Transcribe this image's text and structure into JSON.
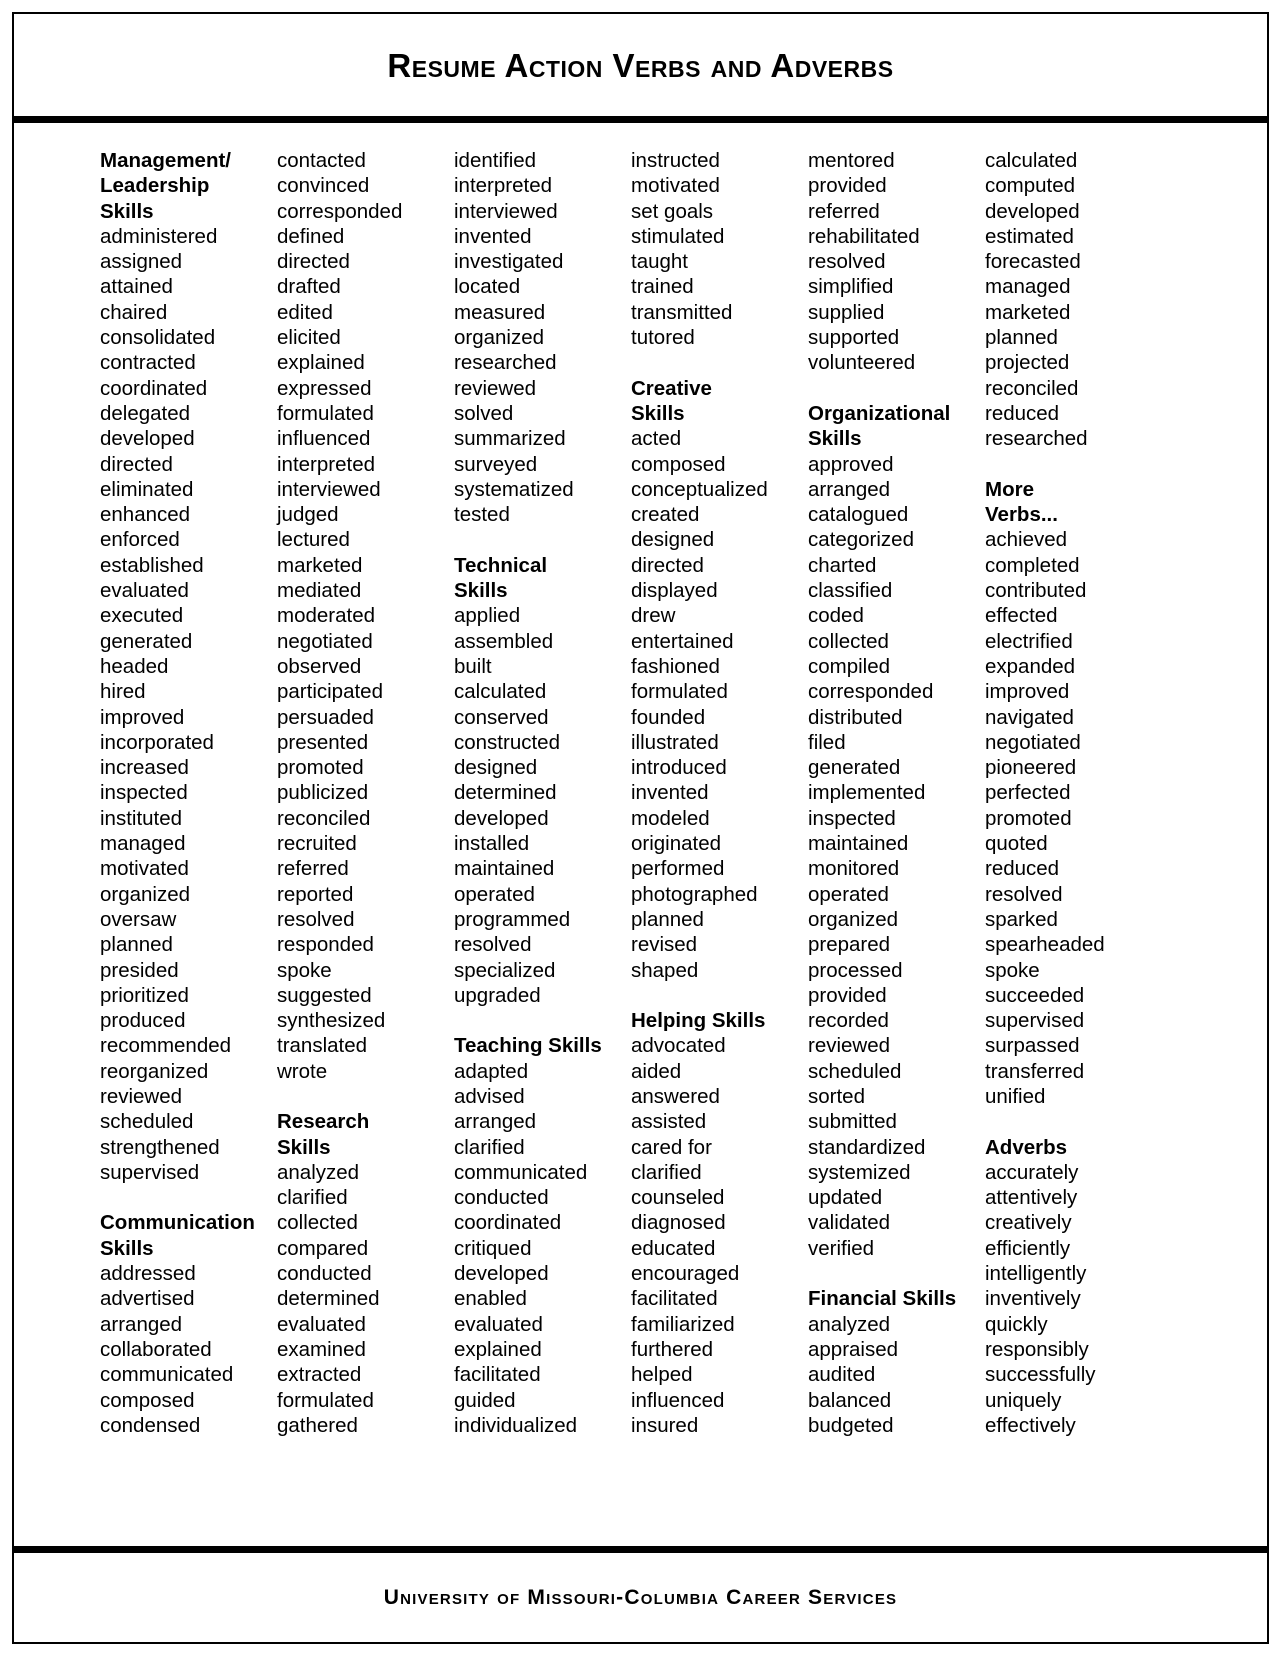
{
  "document": {
    "title": "Resume Action Verbs and Adverbs",
    "footer": "University of Missouri-Columbia Career Services"
  },
  "columns": [
    {
      "name": "column-1",
      "blocks": [
        {
          "type": "category",
          "heading_lines": [
            "Management/",
            "Leadership",
            "Skills"
          ],
          "words": [
            "administered",
            "assigned",
            "attained",
            "chaired",
            "consolidated",
            "contracted",
            "coordinated",
            "delegated",
            "developed",
            "directed",
            "eliminated",
            "enhanced",
            "enforced",
            "established",
            "evaluated",
            "executed",
            "generated",
            "headed",
            "hired",
            "improved",
            "incorporated",
            "increased",
            "inspected",
            "instituted",
            "managed",
            "motivated",
            "organized",
            "oversaw",
            "planned",
            "presided",
            "prioritized",
            "produced",
            "recommended",
            "reorganized",
            "reviewed",
            "scheduled",
            "strengthened",
            "supervised"
          ]
        },
        {
          "type": "category",
          "heading_lines": [
            "Communication",
            "Skills"
          ],
          "words": [
            "addressed",
            "advertised",
            "arranged",
            "collaborated",
            "communicated",
            "composed",
            "condensed"
          ]
        }
      ]
    },
    {
      "name": "column-2",
      "blocks": [
        {
          "type": "continuation",
          "heading_lines": [],
          "words": [
            "contacted",
            "convinced",
            "corresponded",
            "defined",
            "directed",
            "drafted",
            "edited",
            "elicited",
            "explained",
            "expressed",
            "formulated",
            "influenced",
            "interpreted",
            "interviewed",
            "judged",
            "lectured",
            "marketed",
            "mediated",
            "moderated",
            "negotiated",
            "observed",
            "participated",
            "persuaded",
            "presented",
            "promoted",
            "publicized",
            "reconciled",
            "recruited",
            "referred",
            "reported",
            "resolved",
            "responded",
            "spoke",
            "suggested",
            "synthesized",
            "translated",
            "wrote"
          ]
        },
        {
          "type": "category",
          "heading_lines": [
            "Research",
            "Skills"
          ],
          "words": [
            "analyzed",
            "clarified",
            "collected",
            "compared",
            "conducted",
            "determined",
            "evaluated",
            "examined",
            "extracted",
            "formulated",
            "gathered"
          ]
        }
      ]
    },
    {
      "name": "column-3",
      "blocks": [
        {
          "type": "continuation",
          "heading_lines": [],
          "words": [
            "identified",
            "interpreted",
            "interviewed",
            "invented",
            "investigated",
            "located",
            "measured",
            "organized",
            "researched",
            "reviewed",
            "solved",
            "summarized",
            "surveyed",
            "systematized",
            "tested"
          ]
        },
        {
          "type": "category",
          "heading_lines": [
            "Technical",
            "Skills"
          ],
          "words": [
            "applied",
            "assembled",
            "built",
            "calculated",
            "conserved",
            "constructed",
            "designed",
            "determined",
            "developed",
            "installed",
            "maintained",
            "operated",
            "programmed",
            "resolved",
            "specialized",
            "upgraded"
          ]
        },
        {
          "type": "category",
          "heading_lines": [
            "Teaching Skills"
          ],
          "words": [
            "adapted",
            "advised",
            "arranged",
            "clarified",
            "communicated",
            "conducted",
            "coordinated",
            "critiqued",
            "developed",
            "enabled",
            "evaluated",
            "explained",
            "facilitated",
            "guided",
            "individualized"
          ]
        }
      ]
    },
    {
      "name": "column-4",
      "blocks": [
        {
          "type": "continuation",
          "heading_lines": [],
          "words": [
            "instructed",
            "motivated",
            "set goals",
            "stimulated",
            "taught",
            "trained",
            "transmitted",
            "tutored"
          ]
        },
        {
          "type": "category",
          "heading_lines": [
            "Creative",
            "Skills"
          ],
          "words": [
            "acted",
            "composed",
            "conceptualized",
            "created",
            "designed",
            "directed",
            "displayed",
            "drew",
            "entertained",
            "fashioned",
            "formulated",
            "founded",
            "illustrated",
            "introduced",
            "invented",
            "modeled",
            "originated",
            "performed",
            "photographed",
            "planned",
            "revised",
            "shaped"
          ]
        },
        {
          "type": "category",
          "heading_lines": [
            "Helping Skills"
          ],
          "words": [
            "advocated",
            "aided",
            "answered",
            "assisted",
            "cared for",
            "clarified",
            "counseled",
            "diagnosed",
            "educated",
            "encouraged",
            "facilitated",
            "familiarized",
            "furthered",
            "helped",
            "influenced",
            "insured"
          ]
        }
      ]
    },
    {
      "name": "column-5",
      "blocks": [
        {
          "type": "continuation",
          "heading_lines": [],
          "words": [
            "mentored",
            "provided",
            "referred",
            "rehabilitated",
            "resolved",
            "simplified",
            "supplied",
            "supported",
            "volunteered"
          ]
        },
        {
          "type": "category",
          "heading_lines": [
            "Organizational",
            "Skills"
          ],
          "words": [
            "approved",
            "arranged",
            "catalogued",
            "categorized",
            "charted",
            "classified",
            "coded",
            "collected",
            "compiled",
            "corresponded",
            "distributed",
            "filed",
            "generated",
            "implemented",
            "inspected",
            "maintained",
            "monitored",
            "operated",
            "organized",
            "prepared",
            "processed",
            "provided",
            "recorded",
            "reviewed",
            "scheduled",
            "sorted",
            "submitted",
            "standardized",
            "systemized",
            "updated",
            "validated",
            "verified"
          ]
        },
        {
          "type": "category",
          "heading_lines": [
            "Financial Skills"
          ],
          "words": [
            "analyzed",
            "appraised",
            "audited",
            "balanced",
            "budgeted"
          ]
        }
      ]
    },
    {
      "name": "column-6",
      "blocks": [
        {
          "type": "continuation",
          "heading_lines": [],
          "words": [
            "calculated",
            "computed",
            "developed",
            "estimated",
            "forecasted",
            "managed",
            "marketed",
            "planned",
            "projected",
            "reconciled",
            "reduced",
            "researched"
          ]
        },
        {
          "type": "category",
          "heading_lines": [
            "More",
            "Verbs..."
          ],
          "words": [
            "achieved",
            "completed",
            "contributed",
            "effected",
            "electrified",
            "expanded",
            "improved",
            "navigated",
            "negotiated",
            "pioneered",
            "perfected",
            "promoted",
            "quoted",
            "reduced",
            "resolved",
            "sparked",
            "spearheaded",
            "spoke",
            "succeeded",
            "supervised",
            "surpassed",
            "transferred",
            "unified"
          ]
        },
        {
          "type": "category",
          "heading_lines": [
            "Adverbs"
          ],
          "words": [
            "accurately",
            "attentively",
            "creatively",
            "efficiently",
            "intelligently",
            "inventively",
            "quickly",
            "responsibly",
            "successfully",
            "uniquely",
            "effectively"
          ]
        }
      ]
    }
  ]
}
